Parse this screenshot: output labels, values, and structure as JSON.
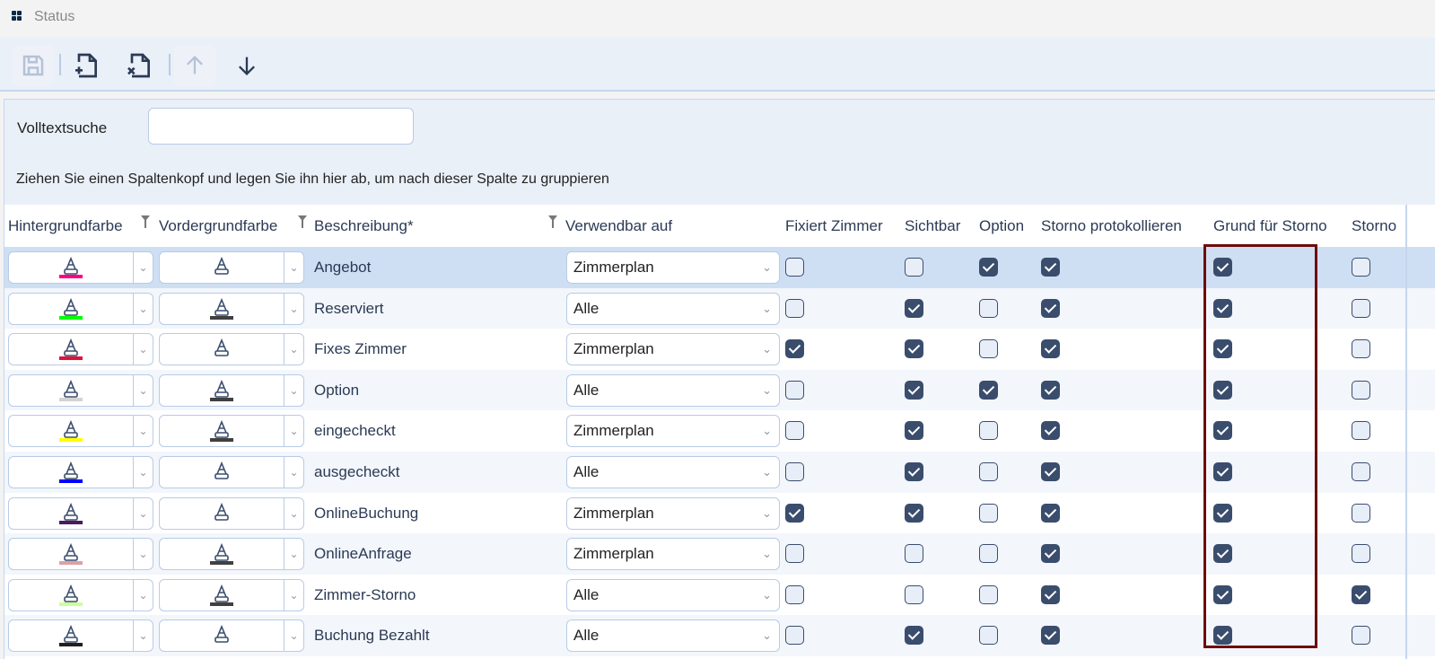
{
  "window": {
    "title": "Status"
  },
  "toolbar": {
    "buttons": [
      {
        "name": "save",
        "icon": "save-icon",
        "enabled": false
      },
      {
        "name": "new",
        "icon": "file-plus-icon",
        "enabled": true
      },
      {
        "name": "delete",
        "icon": "file-x-icon",
        "enabled": true
      },
      {
        "name": "move-up",
        "icon": "arrow-up-icon",
        "enabled": false
      },
      {
        "name": "move-down",
        "icon": "arrow-down-icon",
        "enabled": true
      }
    ]
  },
  "search": {
    "label": "Volltextsuche",
    "value": "",
    "group_hint": "Ziehen Sie einen Spaltenkopf und legen Sie ihn hier ab, um nach dieser Spalte zu gruppieren"
  },
  "columns": {
    "bg": "Hintergrundfarbe",
    "fg": "Vordergrundfarbe",
    "desc": "Beschreibung*",
    "usable": "Verwendbar auf",
    "fixed": "Fixiert Zimmer",
    "visible": "Sichtbar",
    "option": "Option",
    "storno_log": "Storno protokollieren",
    "storno_reason": "Grund für Storno",
    "storno": "Storno"
  },
  "rows": [
    {
      "bg": "#ff0080",
      "fg": null,
      "desc": "Angebot",
      "usable": "Zimmerplan",
      "checks": [
        false,
        false,
        true,
        true,
        true,
        false
      ]
    },
    {
      "bg": "#00ff00",
      "fg": "#404040",
      "desc": "Reserviert",
      "usable": "Alle",
      "checks": [
        false,
        true,
        false,
        true,
        true,
        false
      ]
    },
    {
      "bg": "#dc143c",
      "fg": null,
      "desc": "Fixes Zimmer",
      "usable": "Zimmerplan",
      "checks": [
        true,
        true,
        false,
        true,
        true,
        false
      ]
    },
    {
      "bg": "#d3d3d3",
      "fg": "#404040",
      "desc": "Option",
      "usable": "Alle",
      "checks": [
        false,
        true,
        true,
        true,
        true,
        false
      ]
    },
    {
      "bg": "#ffff00",
      "fg": "#404040",
      "desc": "eingecheckt",
      "usable": "Zimmerplan",
      "checks": [
        false,
        true,
        false,
        true,
        true,
        false
      ]
    },
    {
      "bg": "#0000ff",
      "fg": null,
      "desc": "ausgecheckt",
      "usable": "Alle",
      "checks": [
        false,
        true,
        false,
        true,
        true,
        false
      ]
    },
    {
      "bg": "#4b1a5e",
      "fg": null,
      "desc": "OnlineBuchung",
      "usable": "Zimmerplan",
      "checks": [
        true,
        true,
        false,
        true,
        true,
        false
      ]
    },
    {
      "bg": "#dda0a8",
      "fg": "#404040",
      "desc": "OnlineAnfrage",
      "usable": "Zimmerplan",
      "checks": [
        false,
        false,
        false,
        true,
        true,
        false
      ]
    },
    {
      "bg": "#ccff99",
      "fg": "#404040",
      "desc": "Zimmer-Storno",
      "usable": "Alle",
      "checks": [
        false,
        false,
        false,
        true,
        true,
        true
      ]
    },
    {
      "bg": "#202020",
      "fg": null,
      "desc": "Buchung Bezahlt",
      "usable": "Alle",
      "checks": [
        false,
        true,
        false,
        true,
        true,
        false
      ]
    }
  ],
  "selected_row": 0
}
